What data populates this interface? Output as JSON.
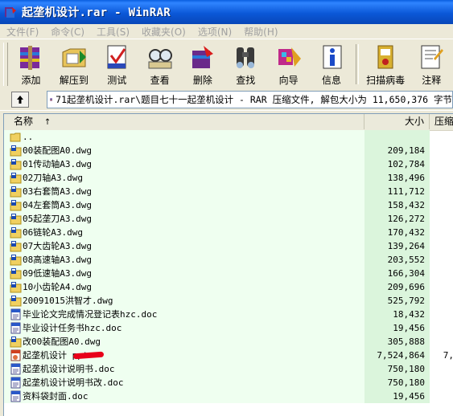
{
  "window": {
    "title": "起垄机设计.rar - WinRAR"
  },
  "menu": [
    "文件(F)",
    "命令(C)",
    "工具(S)",
    "收藏夹(O)",
    "选项(N)",
    "帮助(H)"
  ],
  "toolbar": [
    {
      "label": "添加",
      "icon": "add-icon"
    },
    {
      "label": "解压到",
      "icon": "extract-icon"
    },
    {
      "label": "测试",
      "icon": "test-icon"
    },
    {
      "label": "查看",
      "icon": "view-icon"
    },
    {
      "label": "删除",
      "icon": "delete-icon"
    },
    {
      "label": "查找",
      "icon": "find-icon"
    },
    {
      "label": "向导",
      "icon": "wizard-icon"
    },
    {
      "label": "信息",
      "icon": "info-icon"
    },
    {
      "label": "扫描病毒",
      "icon": "virus-scan-icon"
    },
    {
      "label": "注释",
      "icon": "comment-icon"
    }
  ],
  "address": {
    "path": "71起垄机设计.rar\\题目七十一起垄机设计 - RAR 压缩文件, 解包大小为 11,650,376 字节"
  },
  "columns": {
    "name": "名称",
    "size": "大小",
    "packed": "压缩"
  },
  "files": [
    {
      "name": "..",
      "size": "",
      "packed": "",
      "type": "folder"
    },
    {
      "name": "00装配图A0.dwg",
      "size": "209,184",
      "packed": "",
      "type": "dwg"
    },
    {
      "name": "01传动轴A3.dwg",
      "size": "102,784",
      "packed": "",
      "type": "dwg"
    },
    {
      "name": "02刀轴A3.dwg",
      "size": "138,496",
      "packed": "",
      "type": "dwg"
    },
    {
      "name": "03右套筒A3.dwg",
      "size": "111,712",
      "packed": "",
      "type": "dwg"
    },
    {
      "name": "04左套筒A3.dwg",
      "size": "158,432",
      "packed": "",
      "type": "dwg"
    },
    {
      "name": "05起垄刀A3.dwg",
      "size": "126,272",
      "packed": "",
      "type": "dwg"
    },
    {
      "name": "06链轮A3.dwg",
      "size": "170,432",
      "packed": "",
      "type": "dwg"
    },
    {
      "name": "07大齿轮A3.dwg",
      "size": "139,264",
      "packed": "",
      "type": "dwg"
    },
    {
      "name": "08高速轴A3.dwg",
      "size": "203,552",
      "packed": "",
      "type": "dwg"
    },
    {
      "name": "09低速轴A3.dwg",
      "size": "166,304",
      "packed": "",
      "type": "dwg"
    },
    {
      "name": "10小齿轮A4.dwg",
      "size": "209,696",
      "packed": "",
      "type": "dwg"
    },
    {
      "name": "20091015洪智才.dwg",
      "size": "525,792",
      "packed": "",
      "type": "dwg"
    },
    {
      "name": "毕业论文完成情况登记表hzc.doc",
      "size": "18,432",
      "packed": "",
      "type": "doc"
    },
    {
      "name": "毕业设计任务书hzc.doc",
      "size": "19,456",
      "packed": "",
      "type": "doc"
    },
    {
      "name": "改00装配图A0.dwg",
      "size": "305,888",
      "packed": "",
      "type": "dwg"
    },
    {
      "name": "起垄机设计  ppt",
      "size": "7,524,864",
      "packed": "7,",
      "type": "ppt",
      "redacted": true
    },
    {
      "name": "起垄机设计说明书.doc",
      "size": "750,180",
      "packed": "",
      "type": "doc"
    },
    {
      "name": "起垄机设计说明书改.doc",
      "size": "750,180",
      "packed": "",
      "type": "doc"
    },
    {
      "name": "资料袋封面.doc",
      "size": "19,456",
      "packed": "",
      "type": "doc"
    }
  ],
  "colors": {
    "titlebar": "#0b58d8",
    "list_name_bg": "#effff0",
    "list_size_bg": "#dbf5dc",
    "redaction": "#e8001a"
  }
}
